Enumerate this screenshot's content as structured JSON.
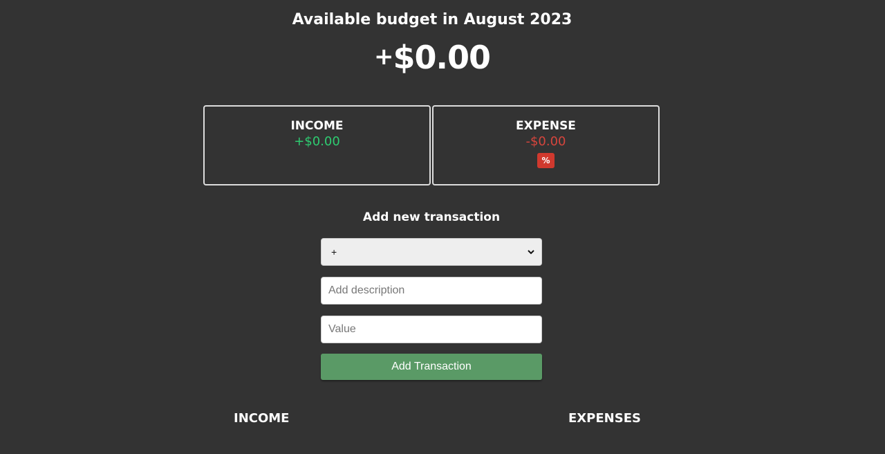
{
  "header": {
    "title": "Available budget in August 2023",
    "total_sign": "+",
    "total_amount": "$0.00"
  },
  "summary": {
    "income": {
      "label": "INCOME",
      "value": "+$0.00",
      "color": "#2ecc71"
    },
    "expense": {
      "label": "EXPENSE",
      "value": "-$0.00",
      "percentage": "%",
      "color": "#d6453d"
    }
  },
  "form": {
    "title": "Add new transaction",
    "type_selected": "+",
    "description_placeholder": "Add description",
    "value_placeholder": "Value",
    "button_label": "Add Transaction",
    "button_color": "#5a9a66"
  },
  "lists": {
    "income_title": "INCOME",
    "expenses_title": "EXPENSES"
  }
}
